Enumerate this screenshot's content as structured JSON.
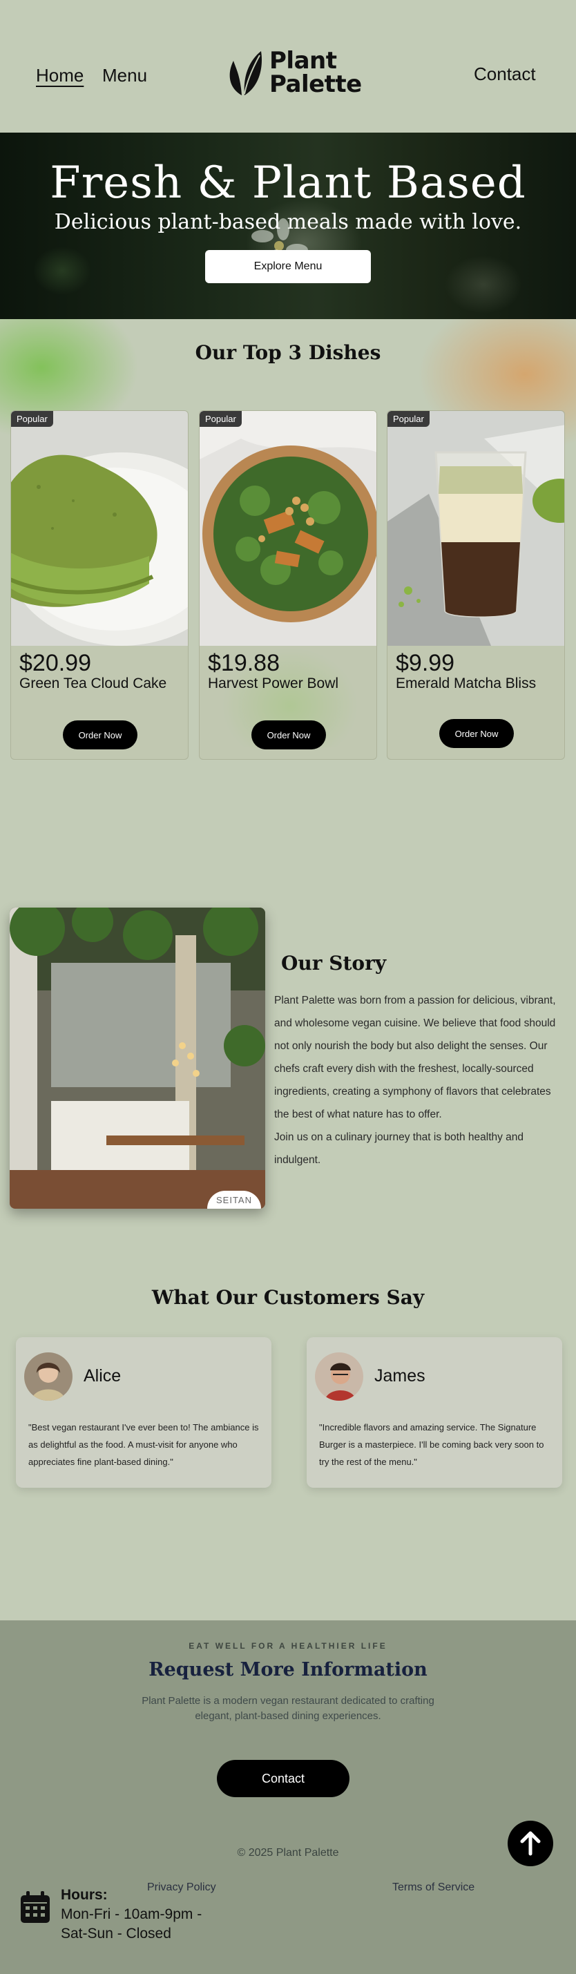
{
  "header": {
    "nav": {
      "home": "Home",
      "menu": "Menu",
      "contact": "Contact"
    },
    "logo": {
      "line1": "Plant",
      "line2": "Palette"
    }
  },
  "hero": {
    "title": "Fresh & Plant Based",
    "subtitle": "Delicious plant-based meals made with love.",
    "button": "Explore Menu"
  },
  "dishes": {
    "title": "Our Top 3 Dishes",
    "items": [
      {
        "badge": "Popular",
        "price": "$20.99",
        "name": "Green Tea Cloud Cake",
        "button": "Order Now"
      },
      {
        "badge": "Popular",
        "price": "$19.88",
        "name": "Harvest Power Bowl",
        "button": "Order Now"
      },
      {
        "badge": "Popular",
        "price": "$9.99",
        "name": "Emerald Matcha Bliss",
        "button": "Order Now"
      }
    ]
  },
  "story": {
    "title": "Our Story",
    "paragraph1": "Plant Palette was born from a passion for delicious, vibrant, and wholesome vegan cuisine. We believe that food should not only nourish the body but also delight the senses. Our chefs craft every dish with the freshest, locally-sourced ingredients, creating a symphony of flavors that celebrates the best of what nature has to offer.",
    "paragraph2": "Join us on a culinary journey that is both healthy and indulgent.",
    "image_badge": "SEITAN"
  },
  "testimonials": {
    "title": "What Our Customers Say",
    "items": [
      {
        "name": "Alice",
        "quote": "\"Best vegan restaurant I've ever been to! The ambiance is as delightful as the food. A must-visit for anyone who appreciates fine plant-based dining.\""
      },
      {
        "name": "James",
        "quote": "\"Incredible flavors and amazing service. The Signature Burger is a masterpiece. I'll be coming back very soon to try the rest of the menu.\""
      }
    ]
  },
  "footer": {
    "eyebrow": "EAT WELL FOR A HEALTHIER LIFE",
    "title": "Request More Information",
    "description": "Plant Palette is a modern vegan restaurant dedicated to crafting elegant, plant-based dining experiences.",
    "contact_button": "Contact",
    "copyright": "© 2025 Plant Palette",
    "privacy": "Privacy Policy",
    "terms": "Terms of Service",
    "hours_label": "Hours:",
    "hours_weekday": "Mon-Fri - 10am-9pm -",
    "hours_weekend": "Sat-Sun - Closed"
  },
  "icons": {
    "logo": "leaf-icon",
    "scroll_top": "arrow-up-icon",
    "hours": "calendar-icon"
  },
  "colors": {
    "background": "#c3ccb7",
    "footer": "#8f9985",
    "footer_title": "#17213e",
    "button": "#000000"
  }
}
